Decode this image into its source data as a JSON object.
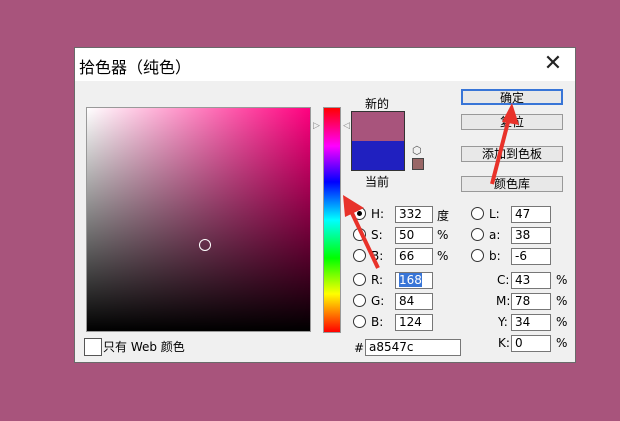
{
  "window": {
    "title": "拾色器（纯色）"
  },
  "swatch": {
    "new_label": "新的",
    "current_label": "当前"
  },
  "buttons": {
    "ok": "确定",
    "reset": "复位",
    "add_swatch": "添加到色板",
    "libraries": "颜色库"
  },
  "web_only_label": "只有 Web 颜色",
  "hsb": [
    {
      "label": "H:",
      "value": "332",
      "unit": "度"
    },
    {
      "label": "S:",
      "value": "50",
      "unit": "%"
    },
    {
      "label": "B:",
      "value": "66",
      "unit": "%"
    }
  ],
  "rgb": [
    {
      "label": "R:",
      "value": "168"
    },
    {
      "label": "G:",
      "value": "84"
    },
    {
      "label": "B:",
      "value": "124"
    }
  ],
  "lab": [
    {
      "label": "L:",
      "value": "47"
    },
    {
      "label": "a:",
      "value": "38"
    },
    {
      "label": "b:",
      "value": "-6"
    }
  ],
  "cmyk": [
    {
      "label": "C:",
      "value": "43",
      "unit": "%"
    },
    {
      "label": "M:",
      "value": "78",
      "unit": "%"
    },
    {
      "label": "Y:",
      "value": "34",
      "unit": "%"
    },
    {
      "label": "K:",
      "value": "0",
      "unit": "%"
    }
  ],
  "hex": {
    "label": "#",
    "value": "a8547c"
  },
  "colors": {
    "new": "#a8547c",
    "current": "#2020c0",
    "arrow": "#e8322a"
  }
}
